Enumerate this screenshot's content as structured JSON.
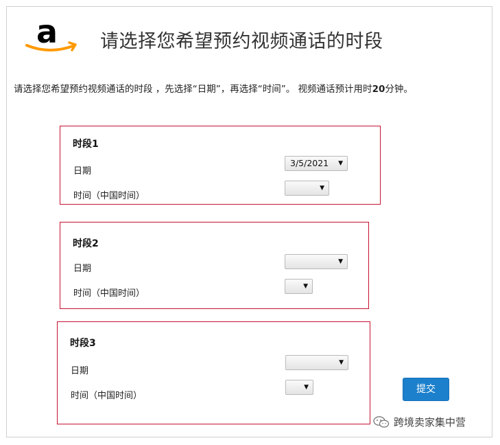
{
  "header": {
    "title": "请选择您希望预约视频通话的时段",
    "logo_icon": "amazon-logo",
    "brand_color": "#000000",
    "smile_color": "#ff9900"
  },
  "instructions": {
    "text_before": "请选择您希望预约视频通话的时段 ，先选择“日期”，再选择“时间”。 视频通话预计用时",
    "bold": "20",
    "text_after": "分钟。"
  },
  "slots": [
    {
      "title": "时段1",
      "date_label": "日期",
      "time_label": "时间（中国时间）",
      "date_value": "3/5/2021",
      "time_value": ""
    },
    {
      "title": "时段2",
      "date_label": "日期",
      "time_label": "时间（中国时间）",
      "date_value": "",
      "time_value": ""
    },
    {
      "title": "时段3",
      "date_label": "日期",
      "time_label": "时间（中国时间）",
      "date_value": "",
      "time_value": ""
    }
  ],
  "submit": {
    "label": "提交",
    "color": "#1c80cc"
  },
  "watermark": {
    "text": "跨境卖家集中营",
    "icon": "wechat-icon"
  },
  "dropdown_arrow": "▼"
}
